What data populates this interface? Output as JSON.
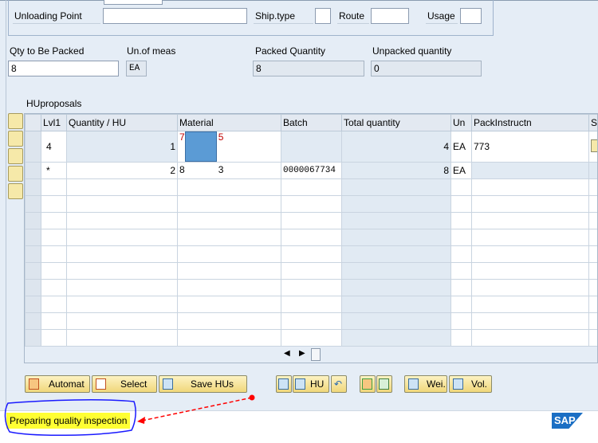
{
  "header_group": {
    "unloading_point_label": "Unloading Point",
    "unloading_point_value": "",
    "ship_type_label": "Ship.type",
    "ship_type_value": "",
    "route_label": "Route",
    "route_value": "",
    "usage_label": "Usage",
    "usage_value": ""
  },
  "quantities": {
    "qty_to_pack_label": "Qty to Be Packed",
    "qty_to_pack_value": "8",
    "uom_label": "Un.of meas",
    "uom_value": "EA",
    "packed_label": "Packed Quantity",
    "packed_value": "8",
    "unpacked_label": "Unpacked quantity",
    "unpacked_value": "0"
  },
  "table": {
    "title": "HUproposals",
    "columns": [
      "Lvl1",
      "Quantity / HU",
      "Material",
      "Batch",
      "Total quantity",
      "Un",
      "PackInstructn",
      "St"
    ],
    "rows": [
      {
        "lvl": "4",
        "qty_hu": "1",
        "material_start": "7",
        "material_end": "5",
        "batch": "",
        "total": "4",
        "un": "EA",
        "pack": "773"
      },
      {
        "lvl": "*",
        "qty_hu": "2",
        "material_start": "8",
        "material_end": "3",
        "batch": "0000067734",
        "total": "8",
        "un": "EA",
        "pack": ""
      }
    ]
  },
  "buttons": {
    "automat": "Automat",
    "select": "Select",
    "save_hus": "Save HUs",
    "hu": "HU",
    "wei": "Wei.",
    "vol": "Vol."
  },
  "status": {
    "message": "Preparing quality inspection",
    "highlight_color": "#ffff33",
    "annotation_color": "#1a1aff",
    "arrow_color": "#ff0000"
  },
  "logo": "SAP"
}
